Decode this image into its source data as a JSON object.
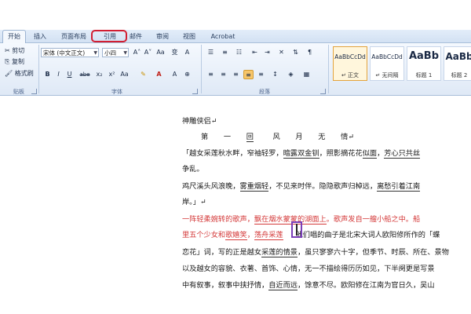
{
  "tabs": [
    "开始",
    "插入",
    "页面布局",
    "引用",
    "邮件",
    "审阅",
    "视图",
    "Acrobat"
  ],
  "clipboard": {
    "cut": "剪切",
    "copy": "复制",
    "format_painter": "格式刷",
    "group_label": "贴板"
  },
  "font": {
    "name": "宋体 (中文正文)",
    "size": "小四",
    "bold": "B",
    "italic": "I",
    "underline": "U",
    "strike": "abe",
    "subscript": "x₂",
    "superscript": "x²",
    "clear": "Aa",
    "grow": "A˄",
    "shrink": "A˅",
    "group_label": "字体"
  },
  "paragraph": {
    "group_label": "段落"
  },
  "styles": [
    {
      "preview": "AaBbCcDd",
      "name": "↵ 正文"
    },
    {
      "preview": "AaBbCcDd",
      "name": "↵ 无间隔"
    },
    {
      "preview": "AaBb",
      "name": "标题 1"
    },
    {
      "preview": "AaBb",
      "name": "标题 2"
    }
  ],
  "document": {
    "heading": "神雕侠侣↵",
    "chapter": [
      "第",
      "一",
      "回",
      "风",
      "月",
      "无",
      "情↵"
    ],
    "lines": [
      {
        "a": "「越女采莲秋水畔，窄袖轻罗，",
        "b": "暗露双金钏",
        "c": "，照影摘花花",
        "d": "似面",
        "e": "，",
        "f": "芳心只共丝"
      },
      {
        "a": "争乱。",
        "b": "",
        "c": "",
        "d": "",
        "e": "",
        "f": ""
      },
      {
        "a": "    鸡尺溪头风浪晚，",
        "b": "雾重烟轻",
        "c": "，不见来时伴。隐隐歌声归棹远，",
        "d": "离愁引着江南",
        "e": "",
        "f": ""
      },
      {
        "a": "岸。」↵",
        "b": "",
        "c": "",
        "d": "",
        "e": "",
        "f": ""
      }
    ],
    "red1": {
      "a": "一阵轻柔婉转的歌声，",
      "b": "飘在烟水蒙蒙的湖面上",
      "c": "。歌声发自一艘小船之中。船"
    },
    "red2": {
      "a": "里五个少女和",
      "b": "歌嬉笑",
      "c": "，",
      "d": "荡舟采莲"
    },
    "after_red2": "他们唱的曲子是北宋大词人欧阳修所作的「蝶",
    "rest": [
      "恋花」词，写的正是越女",
      "采莲的情景",
      "，虽只寥寥六十字，但季节、时辰、所在、景物",
      "以及越女的容貌、衣著、首饰、心情，无一不描绘得历历如见，下半阕更是写景",
      "中有叙事，叙事中挟抒情，",
      "自近而远",
      "，馀意不尽。欧阳修在江南为官日久，吴山"
    ]
  }
}
